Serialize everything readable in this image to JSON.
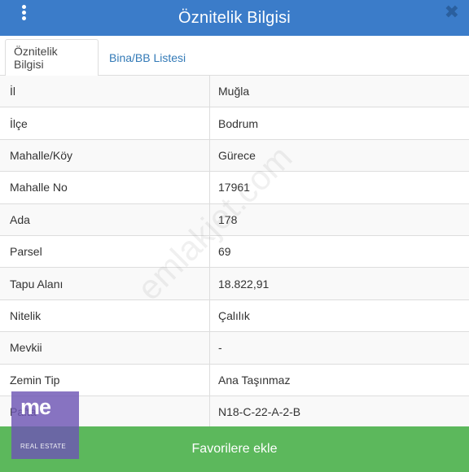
{
  "header": {
    "title": "Öznitelik Bilgisi",
    "menu_icon": "vertical-dots-icon",
    "close_icon": "close-icon",
    "close_glyph": "✖"
  },
  "tabs": [
    {
      "label": "Öznitelik Bilgisi",
      "active": true
    },
    {
      "label": "Bina/BB Listesi",
      "active": false
    }
  ],
  "rows": [
    {
      "label": "İl",
      "value": "Muğla"
    },
    {
      "label": "İlçe",
      "value": "Bodrum"
    },
    {
      "label": "Mahalle/Köy",
      "value": "Gürece"
    },
    {
      "label": "Mahalle No",
      "value": "17961"
    },
    {
      "label": "Ada",
      "value": "178"
    },
    {
      "label": "Parsel",
      "value": "69"
    },
    {
      "label": "Tapu Alanı",
      "value": "18.822,91"
    },
    {
      "label": "Nitelik",
      "value": "Çalılık"
    },
    {
      "label": "Mevkii",
      "value": "-"
    },
    {
      "label": "Zemin Tip",
      "value": "Ana Taşınmaz"
    },
    {
      "label": "Pafta",
      "value": "N18-C-22-A-2-B"
    }
  ],
  "footer": {
    "favorite_label": "Favorilere ekle"
  },
  "logo": {
    "mark": "me",
    "sub": "REAL ESTATE"
  },
  "watermark": "emlakjet.com",
  "colors": {
    "header": "#3b7cc9",
    "button": "#5cb85c",
    "link": "#337ab7"
  }
}
